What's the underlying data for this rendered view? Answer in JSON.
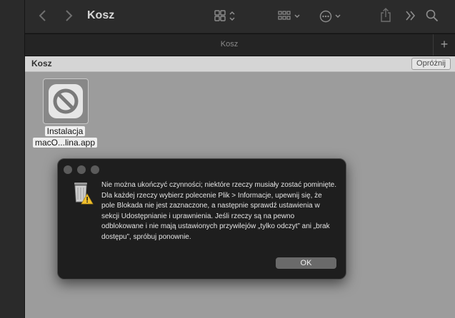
{
  "window": {
    "title": "Kosz"
  },
  "toolbar": {
    "icons": [
      "chevron-left-icon",
      "chevron-right-icon",
      "grid-view-icon",
      "group-icon",
      "more-icon",
      "share-icon",
      "expand-icon",
      "search-icon"
    ]
  },
  "tabbar": {
    "tab_label": "Kosz",
    "new_tab": "+"
  },
  "pathbar": {
    "title": "Kosz",
    "empty_button": "Opróżnij"
  },
  "files": [
    {
      "line1": "Instalacja",
      "line2": "macO...lina.app",
      "icon": "prohibited-app-icon"
    }
  ],
  "dialog": {
    "icon": "trash-warning-icon",
    "message": "Nie można ukończyć czynności; niektóre rzeczy musiały zostać pominięte. Dla każdej rzeczy wybierz polecenie Plik > Informacje, upewnij się, że pole Blokada nie jest zaznaczone, a następnie sprawdź ustawienia w sekcji Udostępnianie i uprawnienia. Jeśli rzeczy są na pewno odblokowane i nie mają ustawionych przywilejów „tylko odczyt” ani „brak dostępu”, spróbuj ponownie.",
    "ok_label": "OK"
  }
}
